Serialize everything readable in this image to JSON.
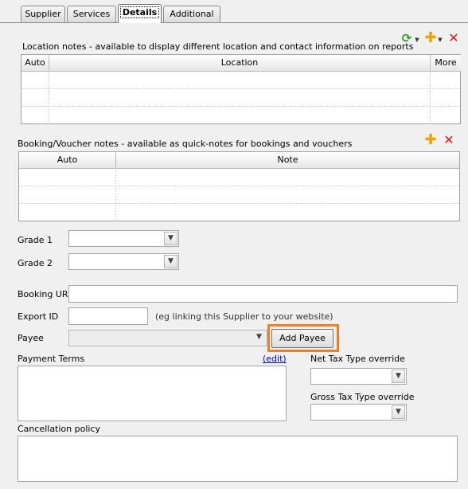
{
  "tabs": [
    {
      "label": "Supplier",
      "active": false
    },
    {
      "label": "Services",
      "active": false
    },
    {
      "label": "Details",
      "active": true
    },
    {
      "label": "Additional",
      "active": false
    }
  ],
  "location_notes": {
    "title": "Location notes - available to display different location and contact information on reports",
    "columns": [
      "Auto",
      "Location",
      "More"
    ],
    "rows": [
      [
        "",
        "",
        ""
      ],
      [
        "",
        "",
        ""
      ],
      [
        "",
        "",
        ""
      ]
    ]
  },
  "booking_notes": {
    "title": "Booking/Voucher notes - available as quick-notes for bookings and vouchers",
    "columns": [
      "Auto",
      "Note"
    ],
    "rows": [
      [
        "",
        ""
      ],
      [
        "",
        ""
      ],
      [
        "",
        ""
      ]
    ]
  },
  "form": {
    "grade1_label": "Grade 1",
    "grade1_value": "",
    "grade2_label": "Grade 2",
    "grade2_value": "",
    "booking_url_label": "Booking URL",
    "booking_url_value": "",
    "export_id_label": "Export ID",
    "export_id_value": "",
    "export_id_hint": "(eg linking this Supplier to your website)",
    "payee_label": "Payee",
    "payee_value": "",
    "add_payee_label": "Add Payee",
    "payment_terms_label": "Payment Terms",
    "payment_terms_edit": "(edit)",
    "payment_terms_value": "",
    "net_tax_label": "Net Tax Type override",
    "net_tax_value": "",
    "gross_tax_label": "Gross Tax Type override",
    "gross_tax_value": "",
    "cancellation_label": "Cancellation policy",
    "cancellation_value": ""
  },
  "icons": {
    "refresh": "refresh-icon",
    "add": "plus-icon",
    "delete": "delete-icon",
    "dropdown": "chevron-down-icon"
  },
  "colors": {
    "highlight": "#ef7c27",
    "add_icon": "#e8a400",
    "delete_icon": "#d51a1a",
    "refresh_icon": "#3a9a2a"
  }
}
